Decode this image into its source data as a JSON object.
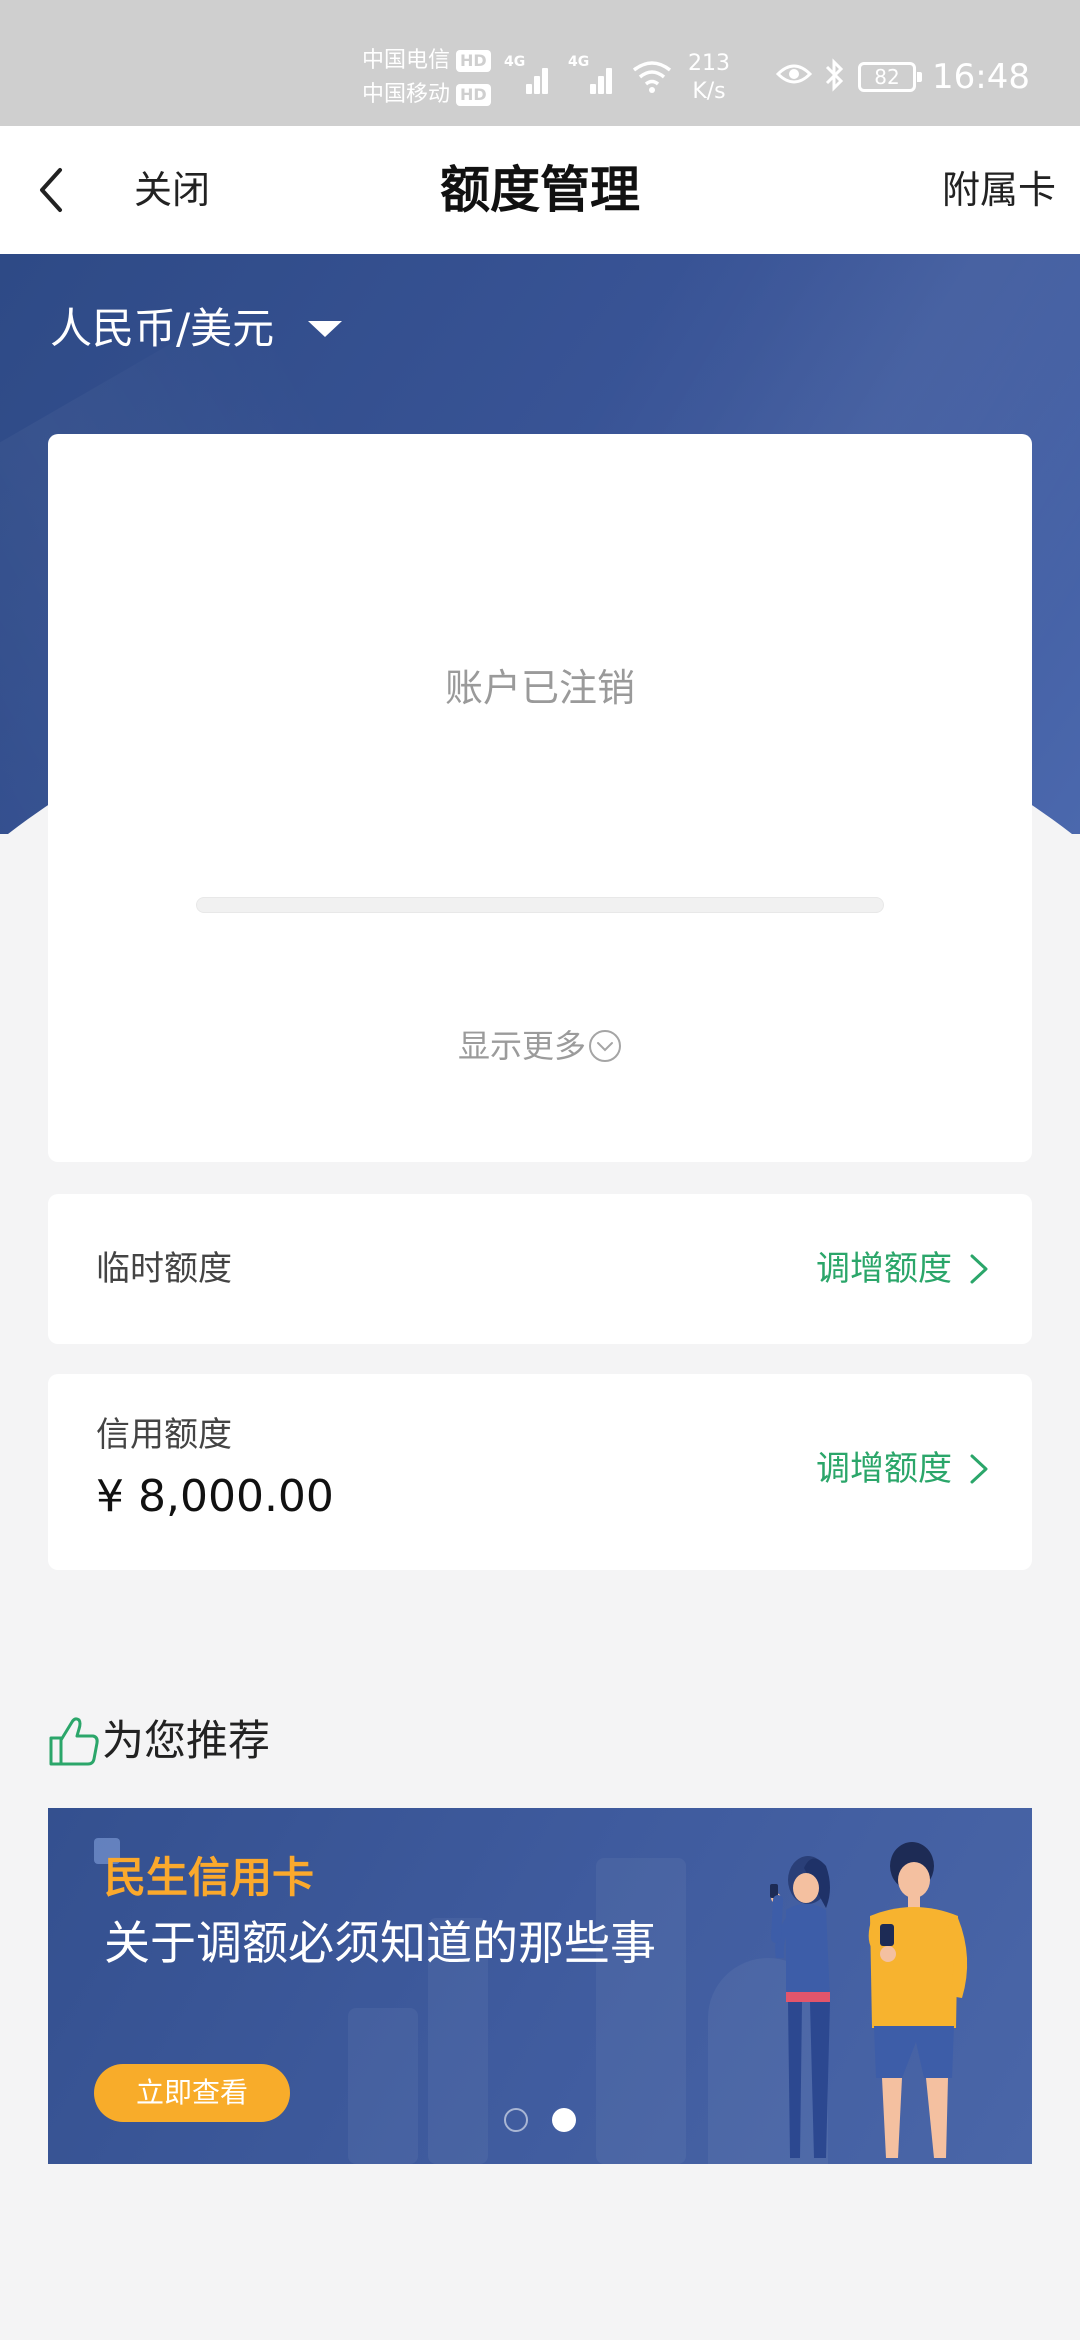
{
  "status_bar": {
    "carrier_1": "中国电信",
    "carrier_2": "中国移动",
    "hd_label": "HD",
    "network_1": "4G",
    "network_2": "4G",
    "speed_value": "213",
    "speed_unit": "K/s",
    "battery": "82",
    "time": "16:48"
  },
  "nav": {
    "back_icon": "chevron-left-icon",
    "close_label": "关闭",
    "title": "额度管理",
    "right_label": "附属卡"
  },
  "header": {
    "currency_selector": "人民币/美元",
    "currency_caret_icon": "caret-down-icon"
  },
  "account_card": {
    "status_text": "账户已注销",
    "show_more_label": "显示更多",
    "show_more_icon": "chevron-circle-down-icon"
  },
  "temporary_limit": {
    "label": "临时额度",
    "action_label": "调增额度"
  },
  "credit_limit": {
    "label": "信用额度",
    "amount": "¥ 8,000.00",
    "action_label": "调增额度"
  },
  "recommend": {
    "icon": "thumbs-up-icon",
    "title": "为您推荐",
    "banner": {
      "brand": "民生信用卡",
      "headline": "关于调额必须知道的那些事",
      "button_label": "立即查看",
      "slide_count": 2,
      "active_slide": 2
    }
  },
  "colors": {
    "accent_green": "#2ba66a",
    "header_blue": "#3a5598",
    "banner_orange": "#f8ac2a"
  }
}
